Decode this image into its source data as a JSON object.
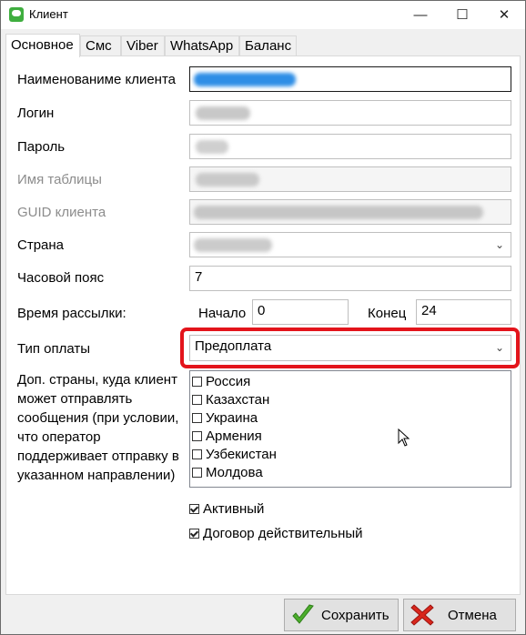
{
  "window": {
    "title": "Клиент",
    "minimize": "—",
    "maximize": "☐",
    "close": "✕"
  },
  "tabs": [
    "Основное",
    "Смс",
    "Viber",
    "WhatsApp",
    "Баланс"
  ],
  "form": {
    "client_name_label": "Наименованиме клиента",
    "login_label": "Логин",
    "password_label": "Пароль",
    "table_name_label": "Имя таблицы",
    "guid_label": "GUID клиента",
    "country_label": "Страна",
    "timezone_label": "Часовой пояс",
    "timezone_value": "7",
    "send_time_label": "Время рассылки:",
    "start_label": "Начало",
    "start_value": "0",
    "end_label": "Конец",
    "end_value": "24",
    "payment_type_label": "Тип оплаты",
    "payment_type_value": "Предоплата",
    "extra_countries_label": "Доп. страны, куда клиент может отправлять сообщения (при условии, что оператор поддерживает отправку в указанном направлении)",
    "extra_countries": [
      {
        "label": "Россия",
        "checked": false
      },
      {
        "label": "Казахстан",
        "checked": false
      },
      {
        "label": "Украина",
        "checked": false
      },
      {
        "label": "Армения",
        "checked": false
      },
      {
        "label": "Узбекистан",
        "checked": false
      },
      {
        "label": "Молдова",
        "checked": false
      }
    ],
    "active_label": "Активный",
    "active_checked": true,
    "contract_label": "Договор действительный",
    "contract_checked": true
  },
  "buttons": {
    "save": "Сохранить",
    "cancel": "Отмена"
  },
  "colors": {
    "highlight": "#e3141b",
    "save_icon": "#4cae2c",
    "cancel_icon": "#d9261c"
  }
}
